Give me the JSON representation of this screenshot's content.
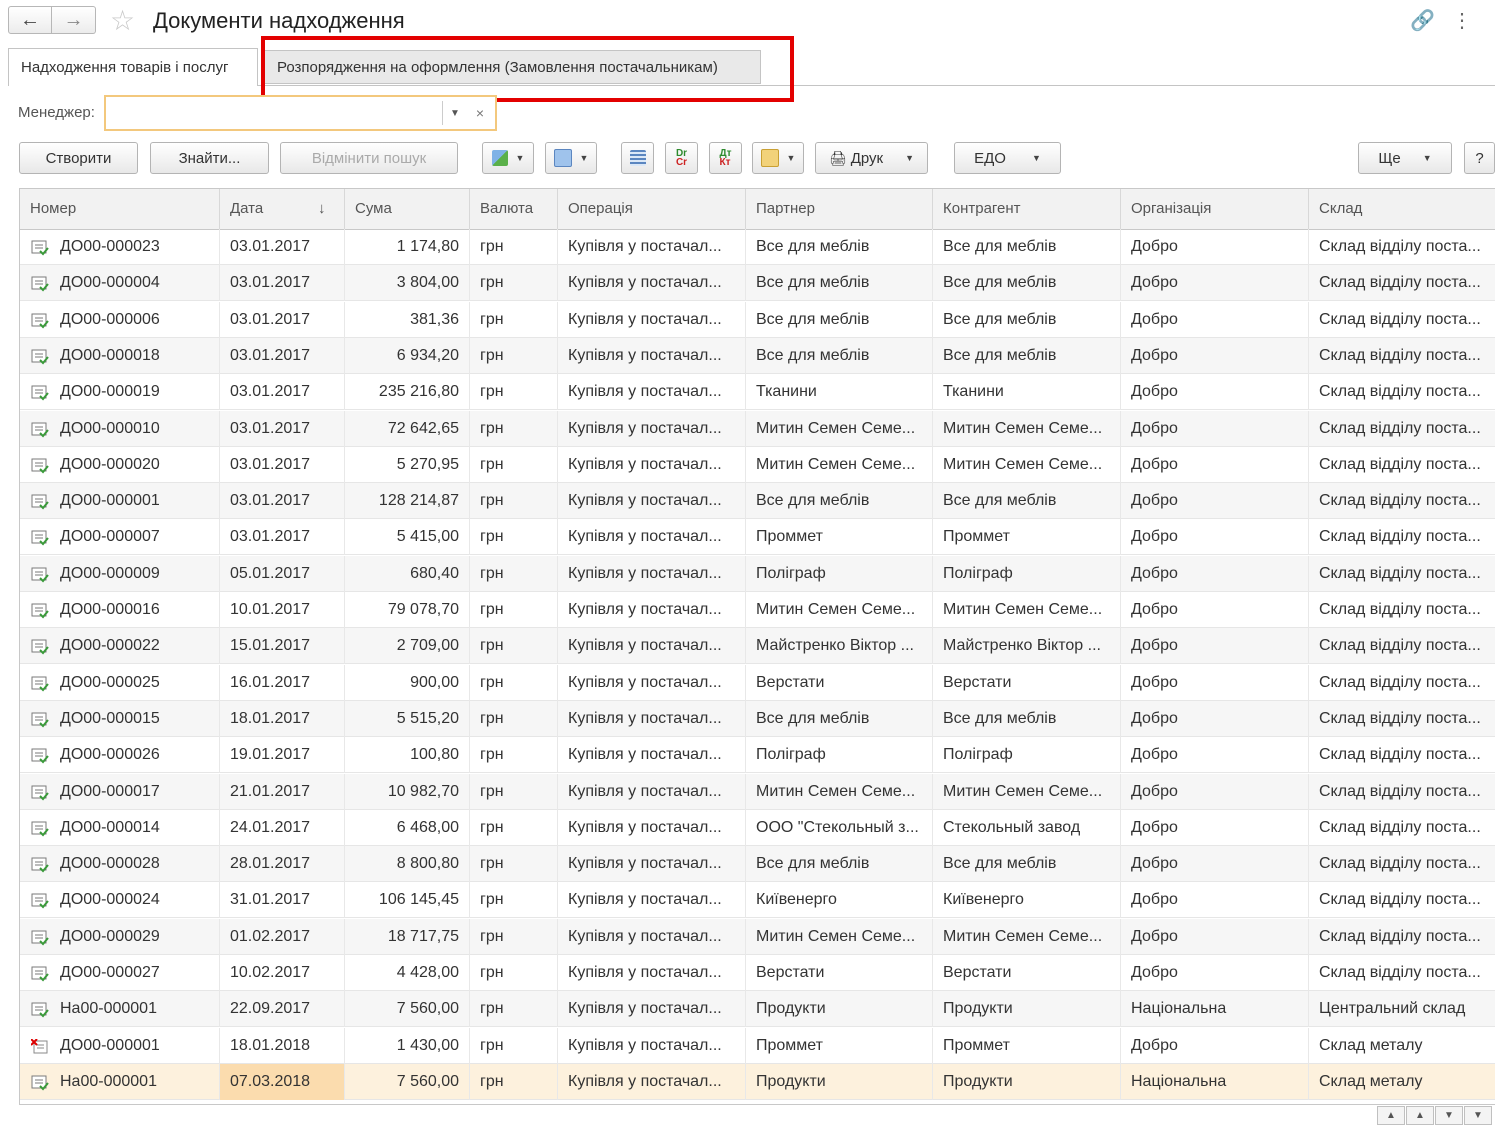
{
  "window": {
    "title": "Документи надходження",
    "back_icon": "arrow-left-icon",
    "forward_icon": "arrow-right-icon",
    "favorite_icon": "star-icon",
    "link_icon": "link-icon",
    "menu_icon": "more-vertical-icon"
  },
  "tabs": [
    {
      "label": "Надходження товарів і послуг"
    },
    {
      "label": "Розпорядження на оформлення (Замовлення постачальникам)"
    }
  ],
  "filter": {
    "manager_label": "Менеджер:",
    "manager_value": ""
  },
  "toolbar": {
    "create": "Створити",
    "find": "Знайти...",
    "cancel_search": "Відмінити пошук",
    "print": "Друк",
    "edo": "ЕДО",
    "more": "Ще",
    "help": "?"
  },
  "columns": [
    "Номер",
    "Дата",
    "Сума",
    "Валюта",
    "Операція",
    "Партнер",
    "Контрагент",
    "Організація",
    "Склад"
  ],
  "rows": [
    {
      "num": "ДО00-000023",
      "date": "03.01.2017",
      "sum": "1 174,80",
      "cur": "грн",
      "op": "Купівля у постачал...",
      "partner": "Все для меблів",
      "contr": "Все для меблів",
      "org": "Добро",
      "wh": "Склад відділу поста..."
    },
    {
      "num": "ДО00-000004",
      "date": "03.01.2017",
      "sum": "3 804,00",
      "cur": "грн",
      "op": "Купівля у постачал...",
      "partner": "Все для меблів",
      "contr": "Все для меблів",
      "org": "Добро",
      "wh": "Склад відділу поста..."
    },
    {
      "num": "ДО00-000006",
      "date": "03.01.2017",
      "sum": "381,36",
      "cur": "грн",
      "op": "Купівля у постачал...",
      "partner": "Все для меблів",
      "contr": "Все для меблів",
      "org": "Добро",
      "wh": "Склад відділу поста..."
    },
    {
      "num": "ДО00-000018",
      "date": "03.01.2017",
      "sum": "6 934,20",
      "cur": "грн",
      "op": "Купівля у постачал...",
      "partner": "Все для меблів",
      "contr": "Все для меблів",
      "org": "Добро",
      "wh": "Склад відділу поста..."
    },
    {
      "num": "ДО00-000019",
      "date": "03.01.2017",
      "sum": "235 216,80",
      "cur": "грн",
      "op": "Купівля у постачал...",
      "partner": "Тканини",
      "contr": "Тканини",
      "org": "Добро",
      "wh": "Склад відділу поста..."
    },
    {
      "num": "ДО00-000010",
      "date": "03.01.2017",
      "sum": "72 642,65",
      "cur": "грн",
      "op": "Купівля у постачал...",
      "partner": "Митин Семен Семе...",
      "contr": "Митин Семен Семе...",
      "org": "Добро",
      "wh": "Склад відділу поста..."
    },
    {
      "num": "ДО00-000020",
      "date": "03.01.2017",
      "sum": "5 270,95",
      "cur": "грн",
      "op": "Купівля у постачал...",
      "partner": "Митин Семен Семе...",
      "contr": "Митин Семен Семе...",
      "org": "Добро",
      "wh": "Склад відділу поста..."
    },
    {
      "num": "ДО00-000001",
      "date": "03.01.2017",
      "sum": "128 214,87",
      "cur": "грн",
      "op": "Купівля у постачал...",
      "partner": "Все для меблів",
      "contr": "Все для меблів",
      "org": "Добро",
      "wh": "Склад відділу поста..."
    },
    {
      "num": "ДО00-000007",
      "date": "03.01.2017",
      "sum": "5 415,00",
      "cur": "грн",
      "op": "Купівля у постачал...",
      "partner": "Проммет",
      "contr": "Проммет",
      "org": "Добро",
      "wh": "Склад відділу поста..."
    },
    {
      "num": "ДО00-000009",
      "date": "05.01.2017",
      "sum": "680,40",
      "cur": "грн",
      "op": "Купівля у постачал...",
      "partner": "Поліграф",
      "contr": "Поліграф",
      "org": "Добро",
      "wh": "Склад відділу поста..."
    },
    {
      "num": "ДО00-000016",
      "date": "10.01.2017",
      "sum": "79 078,70",
      "cur": "грн",
      "op": "Купівля у постачал...",
      "partner": "Митин Семен Семе...",
      "contr": "Митин Семен Семе...",
      "org": "Добро",
      "wh": "Склад відділу поста..."
    },
    {
      "num": "ДО00-000022",
      "date": "15.01.2017",
      "sum": "2 709,00",
      "cur": "грн",
      "op": "Купівля у постачал...",
      "partner": "Майстренко Віктор ...",
      "contr": "Майстренко Віктор ...",
      "org": "Добро",
      "wh": "Склад відділу поста..."
    },
    {
      "num": "ДО00-000025",
      "date": "16.01.2017",
      "sum": "900,00",
      "cur": "грн",
      "op": "Купівля у постачал...",
      "partner": "Верстати",
      "contr": "Верстати",
      "org": "Добро",
      "wh": "Склад відділу поста..."
    },
    {
      "num": "ДО00-000015",
      "date": "18.01.2017",
      "sum": "5 515,20",
      "cur": "грн",
      "op": "Купівля у постачал...",
      "partner": "Все для меблів",
      "contr": "Все для меблів",
      "org": "Добро",
      "wh": "Склад відділу поста..."
    },
    {
      "num": "ДО00-000026",
      "date": "19.01.2017",
      "sum": "100,80",
      "cur": "грн",
      "op": "Купівля у постачал...",
      "partner": "Поліграф",
      "contr": "Поліграф",
      "org": "Добро",
      "wh": "Склад відділу поста..."
    },
    {
      "num": "ДО00-000017",
      "date": "21.01.2017",
      "sum": "10 982,70",
      "cur": "грн",
      "op": "Купівля у постачал...",
      "partner": "Митин Семен Семе...",
      "contr": "Митин Семен Семе...",
      "org": "Добро",
      "wh": "Склад відділу поста..."
    },
    {
      "num": "ДО00-000014",
      "date": "24.01.2017",
      "sum": "6 468,00",
      "cur": "грн",
      "op": "Купівля у постачал...",
      "partner": "ООО \"Стекольный з...",
      "contr": "Стекольный завод",
      "org": "Добро",
      "wh": "Склад відділу поста..."
    },
    {
      "num": "ДО00-000028",
      "date": "28.01.2017",
      "sum": "8 800,80",
      "cur": "грн",
      "op": "Купівля у постачал...",
      "partner": "Все для меблів",
      "contr": "Все для меблів",
      "org": "Добро",
      "wh": "Склад відділу поста..."
    },
    {
      "num": "ДО00-000024",
      "date": "31.01.2017",
      "sum": "106 145,45",
      "cur": "грн",
      "op": "Купівля у постачал...",
      "partner": "Київенерго",
      "contr": "Київенерго",
      "org": "Добро",
      "wh": "Склад відділу поста..."
    },
    {
      "num": "ДО00-000029",
      "date": "01.02.2017",
      "sum": "18 717,75",
      "cur": "грн",
      "op": "Купівля у постачал...",
      "partner": "Митин Семен Семе...",
      "contr": "Митин Семен Семе...",
      "org": "Добро",
      "wh": "Склад відділу поста..."
    },
    {
      "num": "ДО00-000027",
      "date": "10.02.2017",
      "sum": "4 428,00",
      "cur": "грн",
      "op": "Купівля у постачал...",
      "partner": "Верстати",
      "contr": "Верстати",
      "org": "Добро",
      "wh": "Склад відділу поста..."
    },
    {
      "num": "На00-000001",
      "date": "22.09.2017",
      "sum": "7 560,00",
      "cur": "грн",
      "op": "Купівля у постачал...",
      "partner": "Продукти",
      "contr": "Продукти",
      "org": "Національна",
      "wh": "Центральний склад"
    },
    {
      "num": "ДО00-000001",
      "date": "18.01.2018",
      "sum": "1 430,00",
      "cur": "грн",
      "op": "Купівля у постачал...",
      "partner": "Проммет",
      "contr": "Проммет",
      "org": "Добро",
      "wh": "Склад металу",
      "deleted": true
    },
    {
      "num": "На00-000001",
      "date": "07.03.2018",
      "sum": "7 560,00",
      "cur": "грн",
      "op": "Купівля у постачал...",
      "partner": "Продукти",
      "contr": "Продукти",
      "org": "Національна",
      "wh": "Склад металу",
      "selected": true
    }
  ],
  "colors": {
    "highlight": "#e30000",
    "selected_row": "#fdf1dd",
    "selected_cell": "#fbdcae",
    "field_focus": "#f3c87d"
  }
}
